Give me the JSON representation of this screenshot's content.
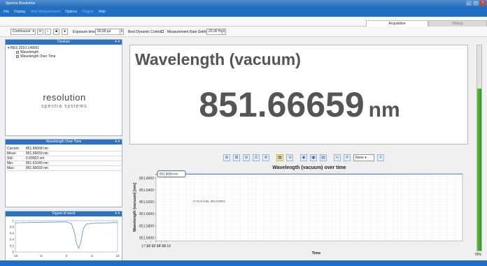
{
  "window": {
    "title": "Spectra Resolution"
  },
  "menu": [
    {
      "label": "File",
      "enabled": true
    },
    {
      "label": "Display",
      "enabled": true
    },
    {
      "label": "Start Measurement",
      "enabled": false
    },
    {
      "label": "Options",
      "enabled": true
    },
    {
      "label": "Plugins",
      "enabled": false
    },
    {
      "label": "Help",
      "enabled": true
    }
  ],
  "tabs": [
    {
      "label": "Acquisition",
      "active": true
    },
    {
      "label": "History",
      "active": false
    }
  ],
  "toolbar": {
    "mode_value": "Continuous",
    "exposure_label": "Exposure time",
    "exposure_value": "50.00 µs",
    "dynamic_label": "Best Dynamic Control",
    "rate_label": "Measurement Rate Setting",
    "rate_value": "20.00 Hz"
  },
  "devices": {
    "title": "Devices",
    "device_name": "RES Z010 145001",
    "items": [
      "Wavelength",
      "Wavelength Over Time"
    ],
    "logo_line1": "resolution",
    "logo_line2": "spectra systems"
  },
  "stats": {
    "title": "Wavelength Over Time",
    "rows": [
      {
        "label": "Current:",
        "value": "851.66658 nm"
      },
      {
        "label": "Mean:",
        "value": "851.66659 nm"
      },
      {
        "label": "Std.:",
        "value": "0.00003 nm"
      },
      {
        "label": "Min:",
        "value": "851.61040 nm"
      },
      {
        "label": "Max:",
        "value": "851.66669 nm"
      }
    ]
  },
  "fom": {
    "title": "Figure of merit",
    "yticks": [
      "1",
      "0.8",
      "0.6",
      "0.4",
      "0.2",
      "0"
    ],
    "xticks": [
      "-10",
      "-5",
      "0",
      "5",
      "10"
    ],
    "xlim": [
      -10,
      10
    ],
    "ylim": [
      0,
      1.0
    ],
    "curve": [
      [
        -10,
        0.93
      ],
      [
        -5,
        0.95
      ],
      [
        0,
        0.96
      ],
      [
        1,
        0.9
      ],
      [
        1.6,
        0.6
      ],
      [
        2,
        0.25
      ],
      [
        2.4,
        0.12
      ],
      [
        2.8,
        0.3
      ],
      [
        3.3,
        0.75
      ],
      [
        4,
        0.9
      ],
      [
        6,
        0.92
      ],
      [
        10,
        0.94
      ]
    ]
  },
  "main": {
    "title": "Wavelength (vacuum)",
    "value": "851.66659",
    "unit": "nm"
  },
  "chart_toolbar": {
    "dropdown_value": "None"
  },
  "chart_data": {
    "type": "line",
    "title": "Wavelength (vacuum) over time",
    "xlabel": "Time",
    "ylabel": "Wavelength (vacuum) [nm]",
    "yticks": [
      "851.6600",
      "851.6400",
      "851.6200",
      "851.6000",
      "851.5800",
      "851.5600"
    ],
    "xticks": [
      "17:10",
      "17:12",
      "17:14",
      "17:16",
      "17:18"
    ],
    "ylim": [
      851.555,
      851.667
    ],
    "xlim": [
      17.14,
      18.33
    ],
    "annotation": "17:09:10.166, 851.622503",
    "current_label": "851.6659 nm",
    "grid": true,
    "series": [
      {
        "x": [
          17.14,
          17.3,
          17.5,
          17.7,
          17.9,
          18.1,
          18.33
        ],
        "y": [
          851.6662,
          851.6664,
          851.6663,
          851.6665,
          851.6664,
          851.6665,
          851.6666
        ]
      }
    ]
  },
  "level": {
    "value": 0.79,
    "label": "79%"
  },
  "colors": {
    "accent": "#1f6fc5",
    "panel_header": "#2d72c0",
    "level_bar": "#3aa626"
  }
}
